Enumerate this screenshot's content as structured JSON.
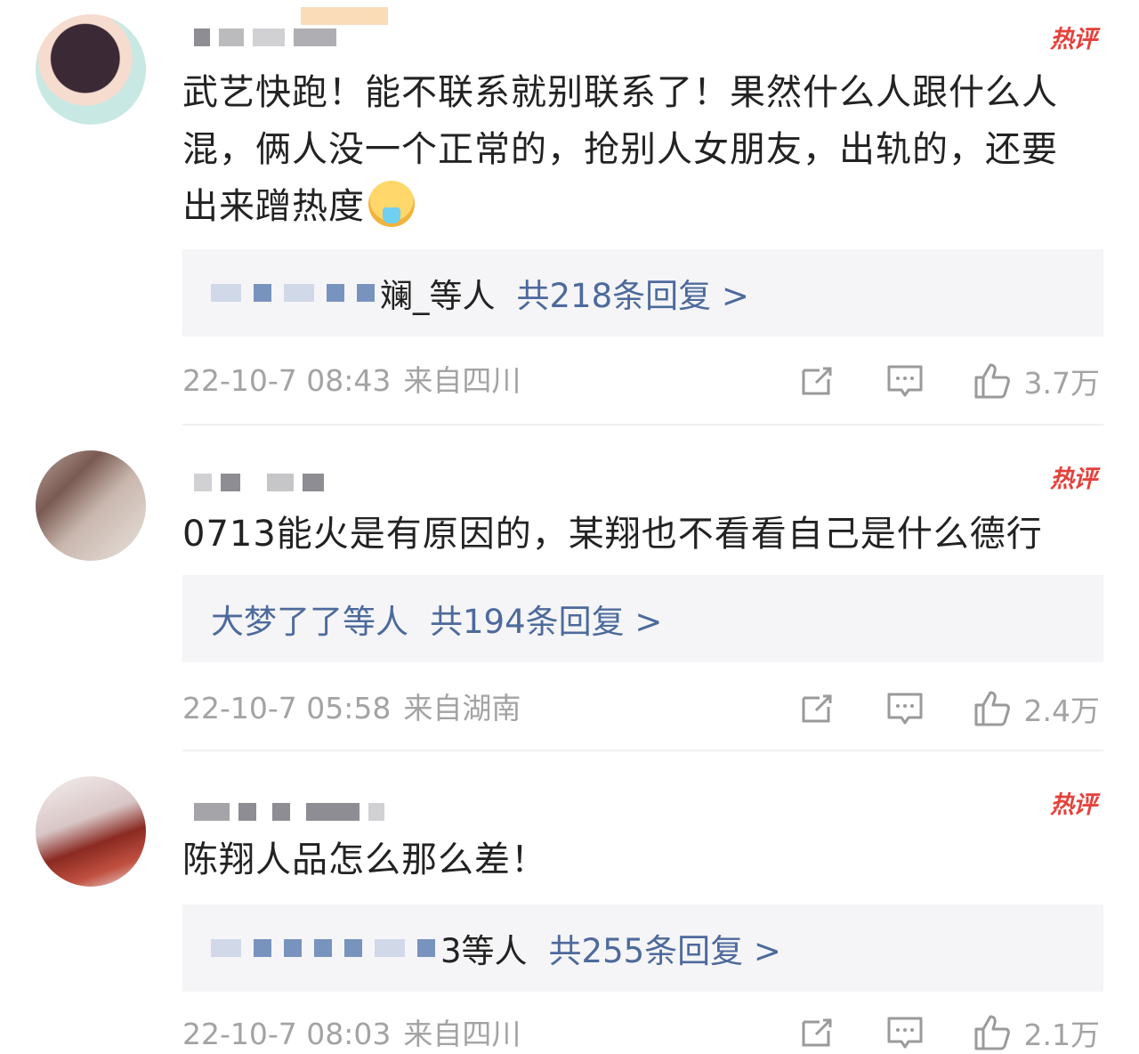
{
  "hot_badge": "热评",
  "comments": [
    {
      "text": "武艺快跑！能不联系就别联系了！果然什么人跟什么人混，俩人没一个正常的，抢别人女朋友，出轨的，还要出来蹭热度",
      "emoji": "vomit-face",
      "reply_names": "斓_等人",
      "reply_count": "共218条回复 >",
      "time": "22-10-7 08:43",
      "source": "来自四川",
      "likes": "3.7万"
    },
    {
      "text": "0713能火是有原因的，某翔也不看看自己是什么德行",
      "reply_names": "大梦了了等人",
      "reply_count": "共194条回复 >",
      "time": "22-10-7 05:58",
      "source": "来自湖南",
      "likes": "2.4万"
    },
    {
      "text": "陈翔人品怎么那么差！",
      "reply_names": "3等人",
      "reply_count": "共255条回复 >",
      "time": "22-10-7 08:03",
      "source": "来自四川",
      "likes": "2.1万"
    }
  ],
  "colors": {
    "link": "#4d6a9c",
    "hot": "#e5413b",
    "meta": "#a3a3a3",
    "text": "#222222"
  },
  "icons": [
    "share-icon",
    "comment-icon",
    "like-icon"
  ]
}
